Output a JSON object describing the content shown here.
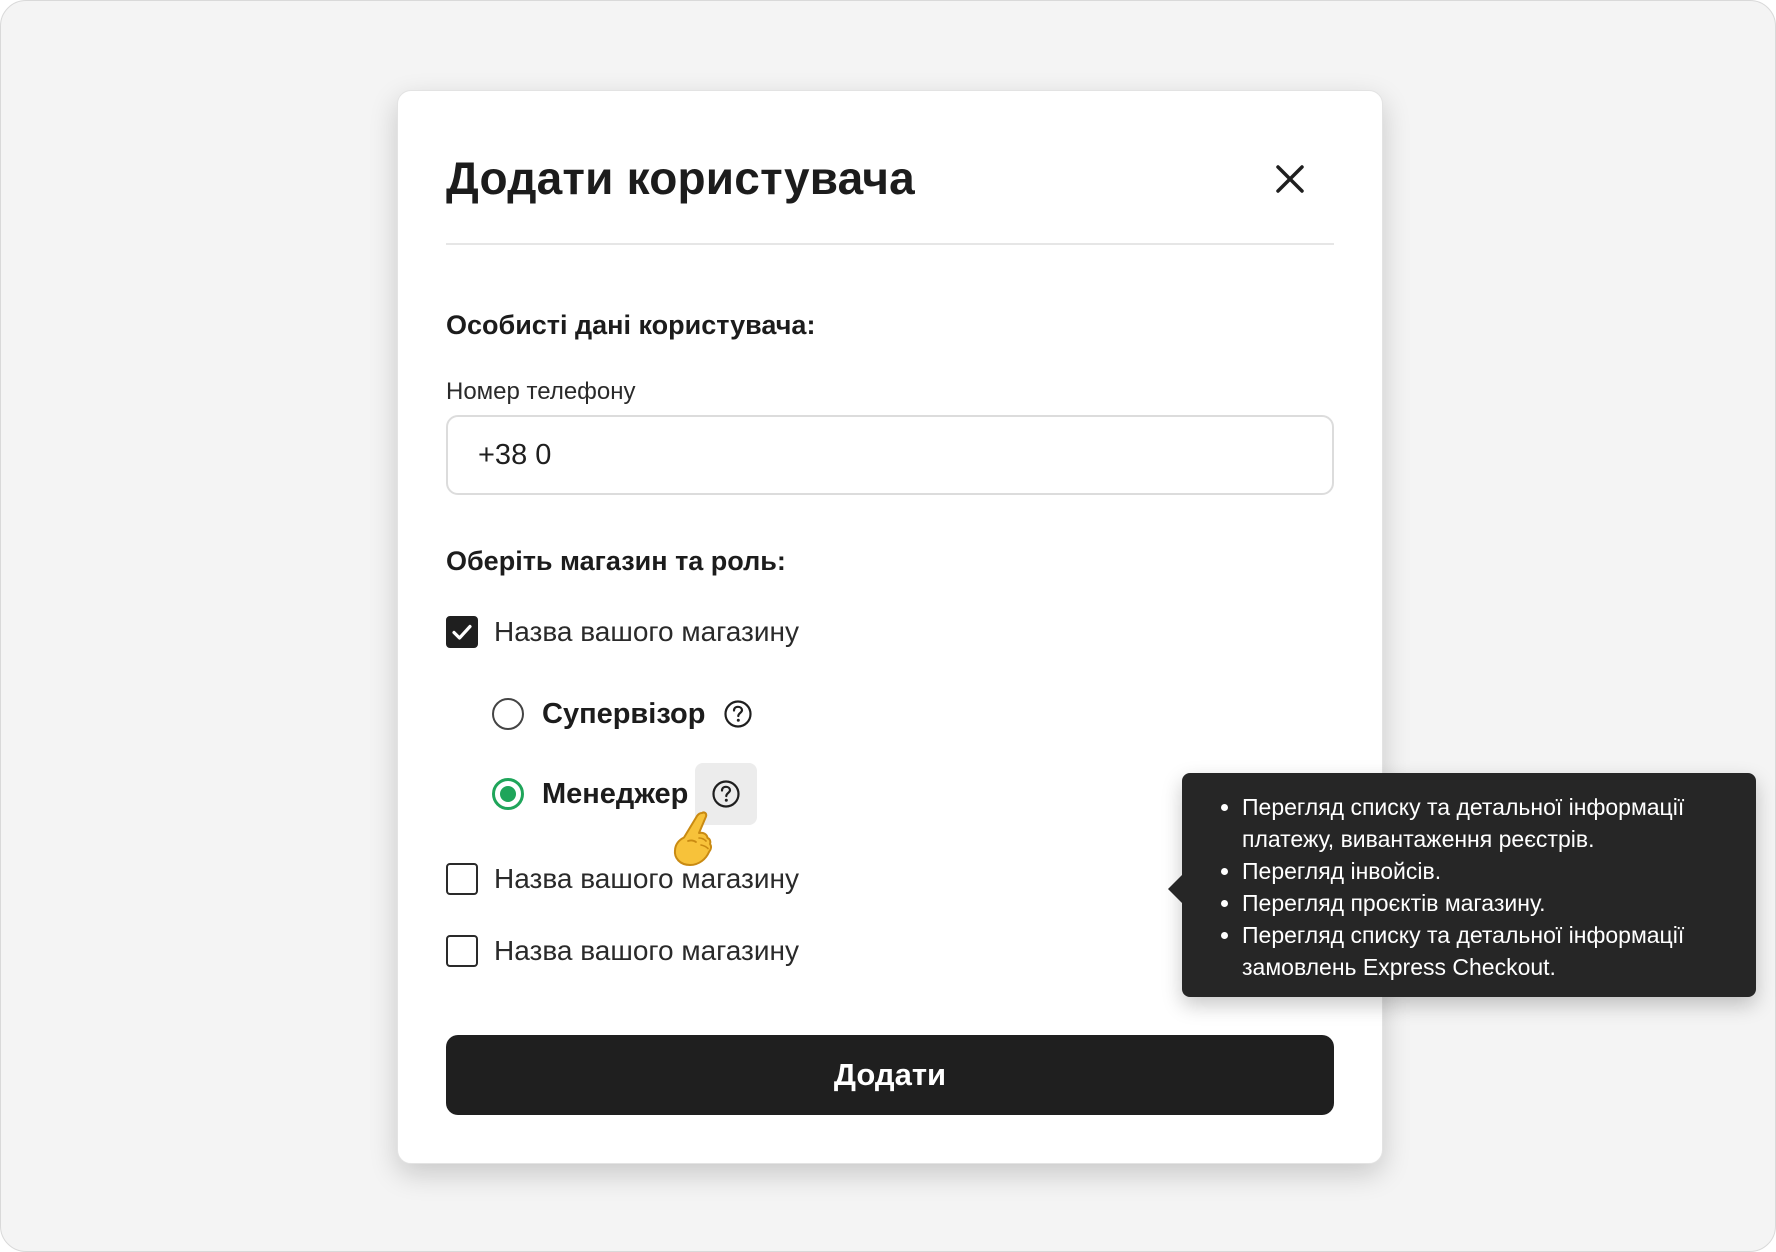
{
  "modal": {
    "title": "Додати користувача",
    "close_icon": "close-icon"
  },
  "personal": {
    "section_title": "Особисті дані користувача:",
    "phone_label": "Номер телефону",
    "phone_value": "+38 0"
  },
  "stores": {
    "section_title": "Оберіть магазин та роль:",
    "items": [
      {
        "label": "Назва вашого магазину",
        "checked": true
      },
      {
        "label": "Назва вашого магазину",
        "checked": false
      },
      {
        "label": "Назва вашого магазину",
        "checked": false
      }
    ]
  },
  "roles": {
    "options": [
      {
        "label": "Супервізор",
        "selected": false
      },
      {
        "label": "Менеджер",
        "selected": true
      }
    ],
    "help_icon": "question-circle-icon"
  },
  "tooltip": {
    "items": [
      "Перегляд списку та детальної інформації платежу, вивантаження реєстрів.",
      "Перегляд інвойсів.",
      "Перегляд проєктів магазину.",
      "Перегляд списку та детальної інформації замовлень Express Checkout."
    ]
  },
  "actions": {
    "submit_label": "Додати"
  },
  "colors": {
    "accent_green": "#1fa55a",
    "dark": "#1f1f1f",
    "tooltip_bg": "#262626",
    "page_bg": "#f4f4f4"
  },
  "cursor_icon": "pointing-hand-cursor-icon"
}
